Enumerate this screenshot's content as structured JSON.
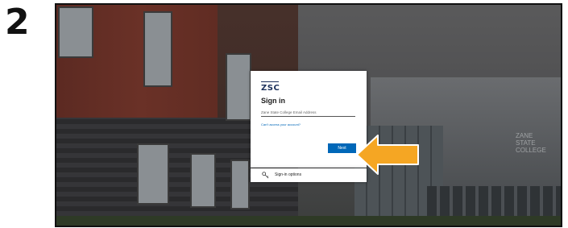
{
  "step": {
    "number": "2"
  },
  "background": {
    "building_sign_lines": [
      "ZANE",
      "STATE",
      "COLLEGE"
    ]
  },
  "signin": {
    "logo_text": "ZSC",
    "title": "Sign in",
    "email_placeholder": "Zane State College Email Address",
    "access_link": "Can't access your account?",
    "next_label": "Next"
  },
  "options": {
    "label": "Sign-in options",
    "icon": "key-icon"
  },
  "annotation": {
    "arrow_color": "#f5a623",
    "points_to": "next-button"
  },
  "colors": {
    "brand_navy": "#1b2f5a",
    "button_blue": "#0067b8"
  }
}
